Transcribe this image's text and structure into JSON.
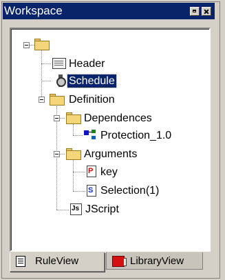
{
  "window": {
    "title": "Workspace"
  },
  "tree": {
    "nodes": [
      {
        "label": "",
        "icon": "folder-icon"
      },
      {
        "label": "Header",
        "icon": "document-icon"
      },
      {
        "label": "Schedule",
        "icon": "stopwatch-icon",
        "selected": true
      },
      {
        "label": "Definition",
        "icon": "folder-icon"
      },
      {
        "label": "Dependences",
        "icon": "folder-icon"
      },
      {
        "label": "Protection_1.0",
        "icon": "network-icon"
      },
      {
        "label": "Arguments",
        "icon": "folder-icon"
      },
      {
        "label": "key",
        "icon": "p-file-icon"
      },
      {
        "label": "Selection(1)",
        "icon": "s-file-icon"
      },
      {
        "label": "JScript",
        "icon": "js-file-icon"
      }
    ]
  },
  "tabs": [
    {
      "label": "RuleView",
      "icon": "ruleview-icon",
      "active": true
    },
    {
      "label": "LibraryView",
      "icon": "libraryview-icon",
      "active": false
    }
  ],
  "colors": {
    "titlebar": "#0a246a",
    "selection": "#0a246a",
    "face": "#d4d0c8"
  }
}
